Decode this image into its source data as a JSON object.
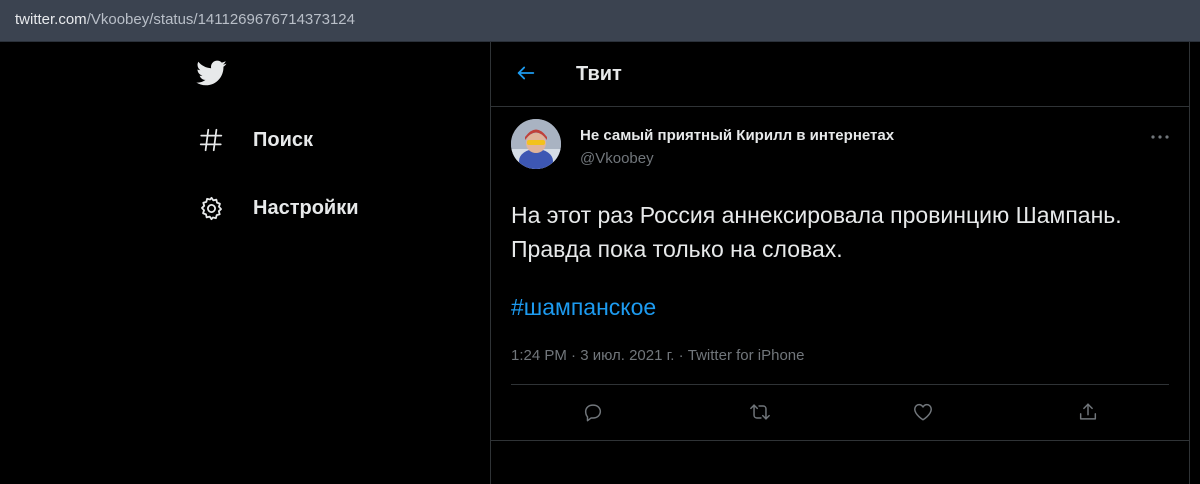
{
  "browser": {
    "url_host": "twitter.com",
    "url_path": "/Vkoobey/status/1411269676714373124"
  },
  "colors": {
    "background": "#000000",
    "text": "#e7e9ea",
    "secondary_text": "#71767b",
    "accent": "#1d9bf0",
    "border": "#2f3336",
    "address_bar": "#3b4350"
  },
  "sidebar": {
    "logo_icon": "twitter-bird-icon",
    "items": [
      {
        "label": "Поиск",
        "icon": "hashtag-icon"
      },
      {
        "label": "Настройки",
        "icon": "gear-icon"
      }
    ]
  },
  "header": {
    "back_icon": "arrow-left-icon",
    "title": "Твит"
  },
  "tweet": {
    "author_name": "Не самый приятный Кирилл в интернетах",
    "author_handle": "@Vkoobey",
    "text": "На этот раз Россия аннексировала провинцию Шампань. Правда пока только на словах.",
    "hashtag": "#шампанское",
    "meta": "1:24 PM · 3 июл. 2021 г. · Twitter for iPhone",
    "more_icon": "more-dots-icon",
    "actions": [
      {
        "name": "reply",
        "icon": "reply-icon"
      },
      {
        "name": "retweet",
        "icon": "retweet-icon"
      },
      {
        "name": "like",
        "icon": "heart-icon"
      },
      {
        "name": "share",
        "icon": "share-icon"
      }
    ]
  }
}
